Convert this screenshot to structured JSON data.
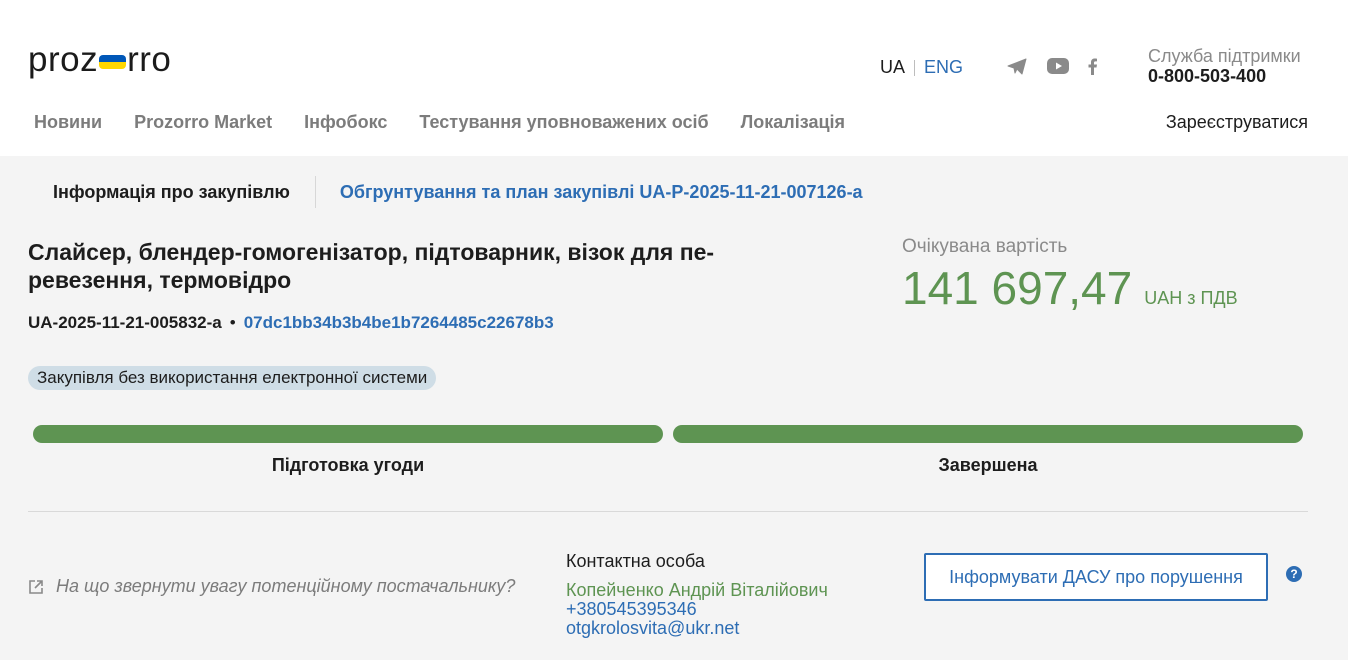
{
  "header": {
    "logo_left": "proz",
    "logo_right": "rro",
    "lang_ua": "UA",
    "lang_eng": "ENG",
    "social_icons": [
      "telegram-icon",
      "youtube-icon",
      "facebook-icon"
    ],
    "support_title": "Служба підтримки",
    "support_phone": "0-800-503-400"
  },
  "nav": {
    "items": [
      "Новини",
      "Prozorro Market",
      "Інфобокс",
      "Тестування уповноважених осіб",
      "Локалізація"
    ],
    "register": "Зареєструватися"
  },
  "tabs": {
    "info": "Інформація про закупівлю",
    "plan": "Обгрунтування та план закупівлі UA-P-2025-11-21-007126-a"
  },
  "tender": {
    "title": "Слайсер, блендер-гомогенізатор, підтоварник, візок для пе-ревезення, термовідро",
    "id": "UA-2025-11-21-005832-a",
    "separator": "•",
    "hash": "07dc1bb34b3b4be1b7264485c22678b3",
    "badge": "Закупівля без використання електронної системи"
  },
  "expected": {
    "label": "Очікувана вартість",
    "amount": "141 697,47",
    "currency": "UAH з ПДВ"
  },
  "stages": {
    "items": [
      {
        "label": "Підготовка угоди",
        "progress": 1.0
      },
      {
        "label": "Завершена",
        "progress": 1.0
      }
    ],
    "color": "#5e9452"
  },
  "footer": {
    "attention": "На що звернути увагу потенційному постачальнику?",
    "contact_heading": "Контактна особа",
    "contact_name": "Копейченко Андрій Віталійович",
    "contact_phone": "+380545395346",
    "contact_email": "otgkrolosvita@ukr.net",
    "dasu_button": "Інформувати ДАСУ про порушення",
    "help": "?"
  },
  "colors": {
    "accent_blue": "#2d6db4",
    "accent_green": "#5e9452",
    "badge_bg": "#cfdde6"
  }
}
